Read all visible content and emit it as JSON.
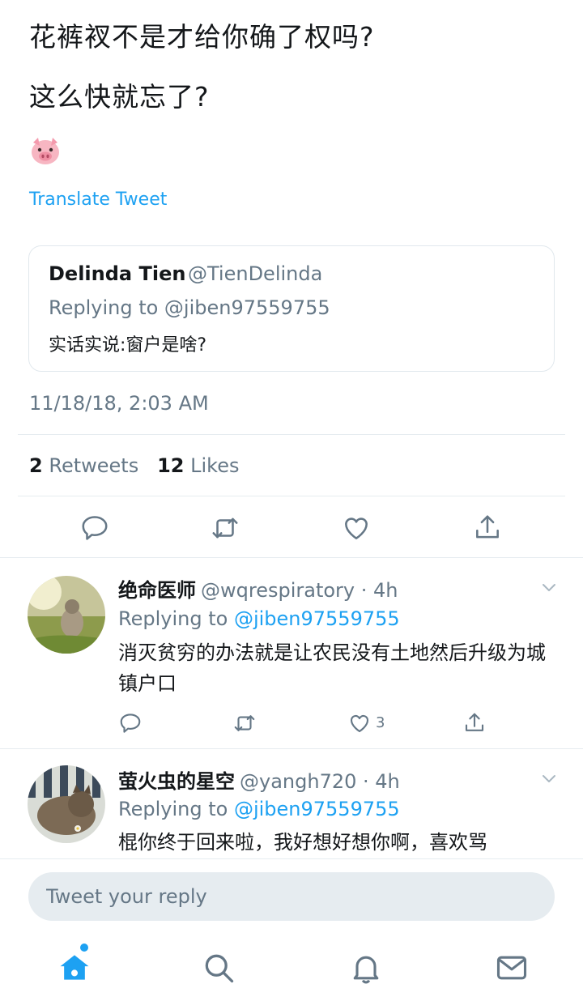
{
  "tweet": {
    "line1": "花裤衩不是才给你确了权吗?",
    "line2": "这么快就忘了?",
    "emoji": "pig-face",
    "translate_label": "Translate Tweet",
    "timestamp": "11/18/18, 2:03 AM"
  },
  "quoted": {
    "name": "Delinda Tien",
    "handle": "@TienDelinda",
    "replying": "Replying to @jiben97559755",
    "body": "实话实说:窗户是啥?"
  },
  "stats": {
    "retweets_count": "2",
    "retweets_label": "Retweets",
    "likes_count": "12",
    "likes_label": "Likes"
  },
  "replies": [
    {
      "name": "绝命医师",
      "handle": "@wqrespiratory · 4h",
      "replying_prefix": "Replying to",
      "mention": "@jiben97559755",
      "body": "消灭贫穷的办法就是让农民没有土地然后升级为城镇户口",
      "likes": "3"
    },
    {
      "name": "萤火虫的星空",
      "handle": "@yangh720 · 4h",
      "replying_prefix": "Replying to",
      "mention": "@jiben97559755",
      "body": "棍你终于回来啦，我好想好想你啊，喜欢骂"
    }
  ],
  "composer": {
    "placeholder": "Tweet your reply"
  },
  "colors": {
    "accent": "#1da1f2",
    "muted": "#657786",
    "text": "#14171a",
    "border": "#e6ecf0"
  },
  "icons": [
    "reply-icon",
    "retweet-icon",
    "like-icon",
    "share-icon",
    "chevron-down-icon",
    "home-icon",
    "search-icon",
    "notifications-icon",
    "messages-icon"
  ]
}
